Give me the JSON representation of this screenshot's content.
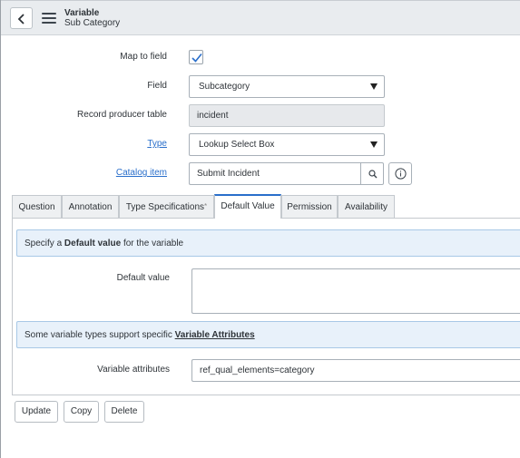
{
  "header": {
    "title": "Variable",
    "subtitle": "Sub Category",
    "back_icon": "chevron-left-icon",
    "menu_icon": "hamburger-menu-icon"
  },
  "form": {
    "map_to_field": {
      "label": "Map to field",
      "checked": true
    },
    "field": {
      "label": "Field",
      "value": "Subcategory"
    },
    "record_producer_table": {
      "label": "Record producer table",
      "value": "incident"
    },
    "type": {
      "label": "Type",
      "value": "Lookup Select Box"
    },
    "catalog_item": {
      "label": "Catalog item",
      "value": "Submit Incident"
    }
  },
  "tabs": [
    {
      "label": "Question"
    },
    {
      "label": "Annotation"
    },
    {
      "label": "Type Specifications",
      "marker": "*"
    },
    {
      "label": "Default Value",
      "active": true
    },
    {
      "label": "Permission"
    },
    {
      "label": "Availability"
    }
  ],
  "default_value_tab": {
    "note1_prefix": "Specify a ",
    "note1_bold": "Default value",
    "note1_suffix": " for the variable",
    "default_value_label": "Default value",
    "default_value": "",
    "note2_prefix": "Some variable types support specific ",
    "note2_link": "Variable Attributes",
    "variable_attributes_label": "Variable attributes",
    "variable_attributes_value": "ref_qual_elements=category"
  },
  "actions": {
    "update": "Update",
    "copy": "Copy",
    "delete": "Delete"
  },
  "colors": {
    "accent": "#2a6fcb",
    "header_bg": "#e9ecef",
    "note_bg": "#e8f1fa"
  }
}
